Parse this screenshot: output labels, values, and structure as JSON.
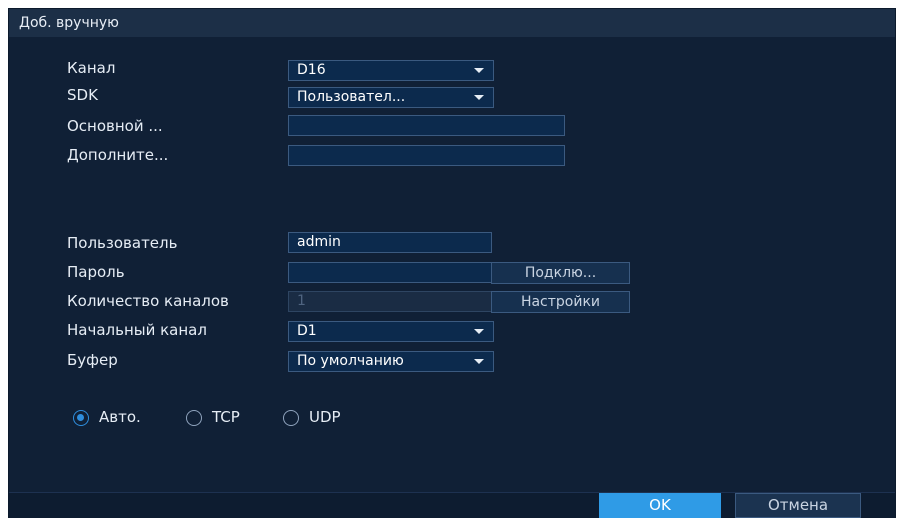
{
  "dialog": {
    "title": "Доб. вручную"
  },
  "fields": {
    "channel": {
      "label": "Канал",
      "value": "D16"
    },
    "sdk": {
      "label": "SDK",
      "value": "Пользовател..."
    },
    "main_stream": {
      "label": "Основной ...",
      "value": ""
    },
    "extra_stream": {
      "label": "Дополните...",
      "value": ""
    },
    "username": {
      "label": "Пользователь",
      "value": "admin"
    },
    "password": {
      "label": "Пароль",
      "value": ""
    },
    "channel_count": {
      "label": "Количество каналов",
      "value": "1"
    },
    "start_channel": {
      "label": "Начальный канал",
      "value": "D1"
    },
    "buffer": {
      "label": "Буфер",
      "value": "По умолчанию"
    }
  },
  "buttons": {
    "connect": "Подклю...",
    "settings": "Настройки",
    "ok": "OK",
    "cancel": "Отмена"
  },
  "protocol": {
    "options": [
      "Авто.",
      "TCP",
      "UDP"
    ],
    "selected": "Авто."
  },
  "colors": {
    "background": "#102036",
    "accent": "#2f9be6"
  }
}
